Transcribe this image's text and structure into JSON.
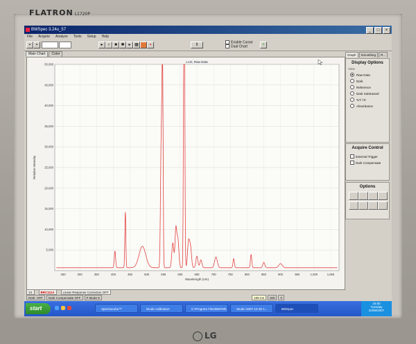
{
  "monitor": {
    "brand": "FLATRON",
    "model": "L1720P",
    "maker": "LG"
  },
  "window": {
    "title": "BWSpec 3.24u_57",
    "controls": [
      "_",
      "□",
      "×"
    ]
  },
  "menu": [
    "File",
    "Acquire",
    "Analyze",
    "Tools",
    "Setup",
    "Help"
  ],
  "toolbar": {
    "enable_cursor": "Enable Cursor",
    "dual_chart": "Dual Chart"
  },
  "tabs": [
    "Main Chart",
    "Color"
  ],
  "panel": {
    "tabs": [
      "Graph",
      "Smoothing",
      "R..."
    ],
    "display_title": "Display Options",
    "display_group": "View",
    "display_options": [
      "Raw Data",
      "Dark",
      "Reference",
      "Dark Subtracted",
      "%T / R",
      "Absorbance"
    ],
    "selected": "Raw Data",
    "acquire_title": "Acquire Control",
    "acquire_options": [
      "External Trigger",
      "Dark Compensate"
    ],
    "options_title": "Options"
  },
  "status": {
    "index": "1X",
    "device": "BRC111A",
    "linearity": "Linear Response Correction OFF",
    "dark": "Dark: OFF",
    "dark_comp": "Dark Compensate OFF",
    "mode": "P Mode 8",
    "integration": "100 ms",
    "avg": "300",
    "smooth": "0"
  },
  "taskbar": {
    "start": "start",
    "items": [
      "Spectracube™",
      "Diode calibration",
      "C:\\Program Files\\BWTek\\...",
      "Studio 2007-12-30 1...",
      "BWSpec"
    ],
    "active": 4,
    "clock": "15:50",
    "day": "Tuesday",
    "date": "20/05/2007"
  },
  "chart_data": {
    "type": "line",
    "title": "LAO, Raw Data",
    "xlabel": "Wavelength (nm)",
    "ylabel": "Relative Intensity",
    "xlim": [
      225,
      1075
    ],
    "ylim": [
      0,
      50000
    ],
    "xticks": [
      250,
      300,
      350,
      400,
      450,
      500,
      550,
      600,
      650,
      700,
      750,
      800,
      850,
      900,
      950,
      1000,
      1050
    ],
    "yticks": [
      5000,
      10000,
      15000,
      20000,
      25000,
      30000,
      35000,
      40000,
      45000,
      50000
    ],
    "baseline": 700,
    "color": "#e2413f",
    "grid": true,
    "peaks": [
      {
        "x": 405,
        "y": 4000,
        "w": 2
      },
      {
        "x": 436,
        "y": 13500,
        "w": 1.5
      },
      {
        "x": 487,
        "y": 5200,
        "w": 10
      },
      {
        "x": 543,
        "y": 28000,
        "w": 2
      },
      {
        "x": 546,
        "y": 26500,
        "w": 1.5
      },
      {
        "x": 548,
        "y": 33000,
        "w": 1.5
      },
      {
        "x": 578,
        "y": 6000,
        "w": 3
      },
      {
        "x": 587,
        "y": 9000,
        "w": 2.5
      },
      {
        "x": 593,
        "y": 7000,
        "w": 3
      },
      {
        "x": 611,
        "y": 49000,
        "w": 1.5
      },
      {
        "x": 613,
        "y": 42000,
        "w": 1.5
      },
      {
        "x": 625,
        "y": 6200,
        "w": 3
      },
      {
        "x": 631,
        "y": 4700,
        "w": 3
      },
      {
        "x": 650,
        "y": 2800,
        "w": 3
      },
      {
        "x": 662,
        "y": 1900,
        "w": 3
      },
      {
        "x": 707,
        "y": 2600,
        "w": 4
      },
      {
        "x": 760,
        "y": 2200,
        "w": 2
      },
      {
        "x": 812,
        "y": 3200,
        "w": 2
      },
      {
        "x": 850,
        "y": 1300,
        "w": 3
      },
      {
        "x": 900,
        "y": 1000,
        "w": 5
      }
    ]
  }
}
